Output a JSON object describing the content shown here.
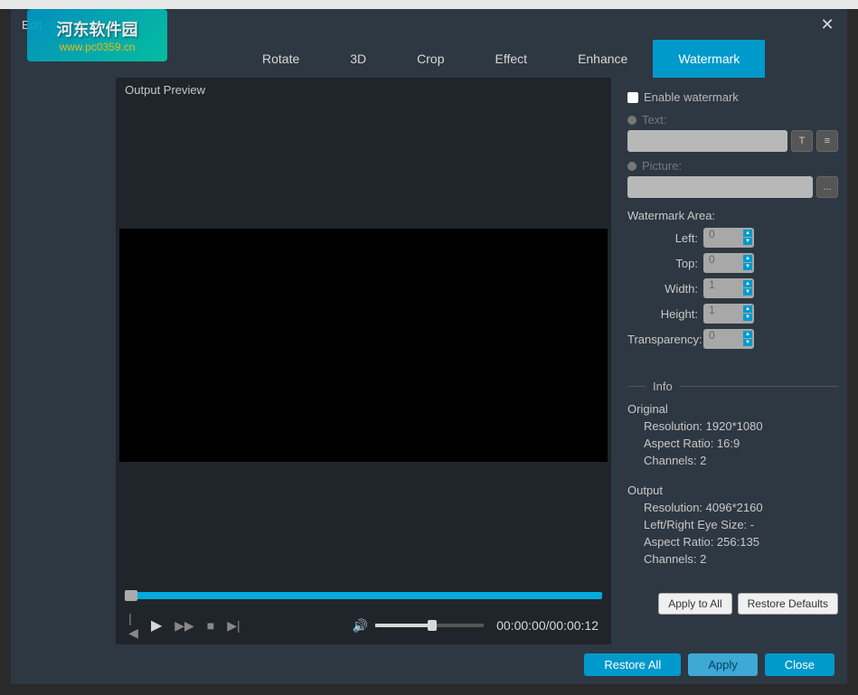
{
  "branding": {
    "cn_text": "河东软件园",
    "url_text": "www.pc0359.cn"
  },
  "modal": {
    "title": "Edit",
    "close_icon": "✕"
  },
  "tabs": [
    {
      "label": "Rotate",
      "active": false
    },
    {
      "label": "3D",
      "active": false
    },
    {
      "label": "Crop",
      "active": false
    },
    {
      "label": "Effect",
      "active": false
    },
    {
      "label": "Enhance",
      "active": false
    },
    {
      "label": "Watermark",
      "active": true
    }
  ],
  "preview": {
    "label": "Output Preview"
  },
  "player": {
    "time_current": "00:00:00",
    "time_total": "00:00:12",
    "volume_percent": 50
  },
  "watermark": {
    "enable_label": "Enable watermark",
    "text_label": "Text:",
    "text_value": "",
    "picture_label": "Picture:",
    "picture_value": "",
    "text_style_icon": "T",
    "text_more_icon": "≡",
    "browse_icon": "...",
    "area_label": "Watermark Area:",
    "fields": {
      "left": {
        "label": "Left:",
        "value": "0"
      },
      "top": {
        "label": "Top:",
        "value": "0"
      },
      "width": {
        "label": "Width:",
        "value": "1"
      },
      "height": {
        "label": "Height:",
        "value": "1"
      },
      "transparency": {
        "label": "Transparency:",
        "value": "0"
      }
    }
  },
  "info": {
    "header": "Info",
    "original": {
      "heading": "Original",
      "resolution": "Resolution: 1920*1080",
      "aspect": "Aspect Ratio: 16:9",
      "channels": "Channels: 2"
    },
    "output": {
      "heading": "Output",
      "resolution": "Resolution: 4096*2160",
      "eye_size": "Left/Right Eye Size: -",
      "aspect": "Aspect Ratio: 256:135",
      "channels": "Channels: 2"
    }
  },
  "panel_buttons": {
    "apply_to_all": "Apply to All",
    "restore_defaults": "Restore Defaults"
  },
  "footer": {
    "restore_all": "Restore All",
    "apply": "Apply",
    "close": "Close"
  }
}
